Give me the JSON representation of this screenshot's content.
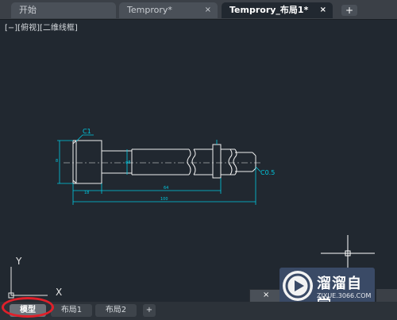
{
  "tabs": [
    {
      "label": "开始",
      "active": false,
      "has_close": false
    },
    {
      "label": "Temprory*",
      "active": false,
      "has_close": true
    },
    {
      "label": "Temprory_布局1*",
      "active": true,
      "has_close": true
    }
  ],
  "tab_close_glyph": "×",
  "new_tab_glyph": "+",
  "viewport_label": "[−][俯视][二维线框]",
  "drawing": {
    "chamfer_label": "C1",
    "chamfer_right_label": "C0.5",
    "dim_diameter_a": "8",
    "dim_diameter_b": "φ8",
    "dim_small_bottom": "18",
    "dim_mid": "64",
    "dim_total": "100"
  },
  "ucs": {
    "y_label": "Y",
    "x_label": "X"
  },
  "layout_tabs": [
    {
      "label": "模型",
      "active": true
    },
    {
      "label": "布局1",
      "active": false
    },
    {
      "label": "布局2",
      "active": false
    }
  ],
  "layout_add_glyph": "+",
  "cmdbar_glyph": "×",
  "watermark": {
    "title": "溜溜自学",
    "url": "ZIXUE.3066.COM"
  },
  "colors": {
    "accent": "#00c8e0",
    "highlight": "#e0202a",
    "background": "#212830"
  }
}
